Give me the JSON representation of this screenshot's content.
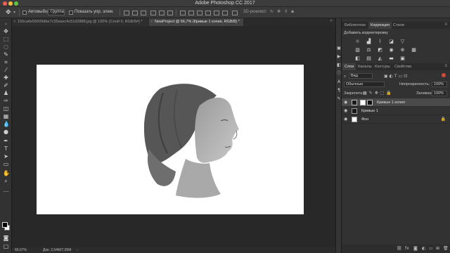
{
  "window": {
    "title": "Adobe Photoshop CC 2017"
  },
  "options": {
    "auto_select_label": "Автовыбор:",
    "auto_select_value": "Группа",
    "show_transform_label": "Показать упр. элем.",
    "mode_3d_label": "3D-режим:"
  },
  "documents": {
    "tabs": [
      {
        "label": "155ca6e56609dbe7c35eaec4c51d2888.jpg @ 100% (Слой 0, RGB/8#) *",
        "active": false
      },
      {
        "label": "NewProject @ 66,7% (Кривые 1 копия, RGB/8) *",
        "active": true
      }
    ]
  },
  "status": {
    "zoom": "66,67%",
    "doc_size": "Док: 2,54M/7,05M"
  },
  "panels": {
    "top_tabs": [
      "Библиотеки",
      "Коррекция",
      "Стили"
    ],
    "active_top_tab": "Коррекция",
    "adjustments_header": "Добавить корректировку",
    "layers_tabs": [
      "Слои",
      "Каналы",
      "Контуры",
      "Свойства"
    ],
    "filter_label": "Вид",
    "blend_mode": "Обычные",
    "opacity_label": "Непрозрачность:",
    "opacity_value": "100%",
    "lock_label": "Закрепить:",
    "fill_label": "Заливка:",
    "fill_value": "100%",
    "layers": [
      {
        "name": "Кривые 1 копия",
        "selected": true
      },
      {
        "name": "Кривые 1",
        "selected": false
      },
      {
        "name": "Фон",
        "selected": false
      }
    ]
  },
  "colors": {
    "foreground": "#000000",
    "background": "#ffffff",
    "selected_layer": "#4a4a4a"
  }
}
